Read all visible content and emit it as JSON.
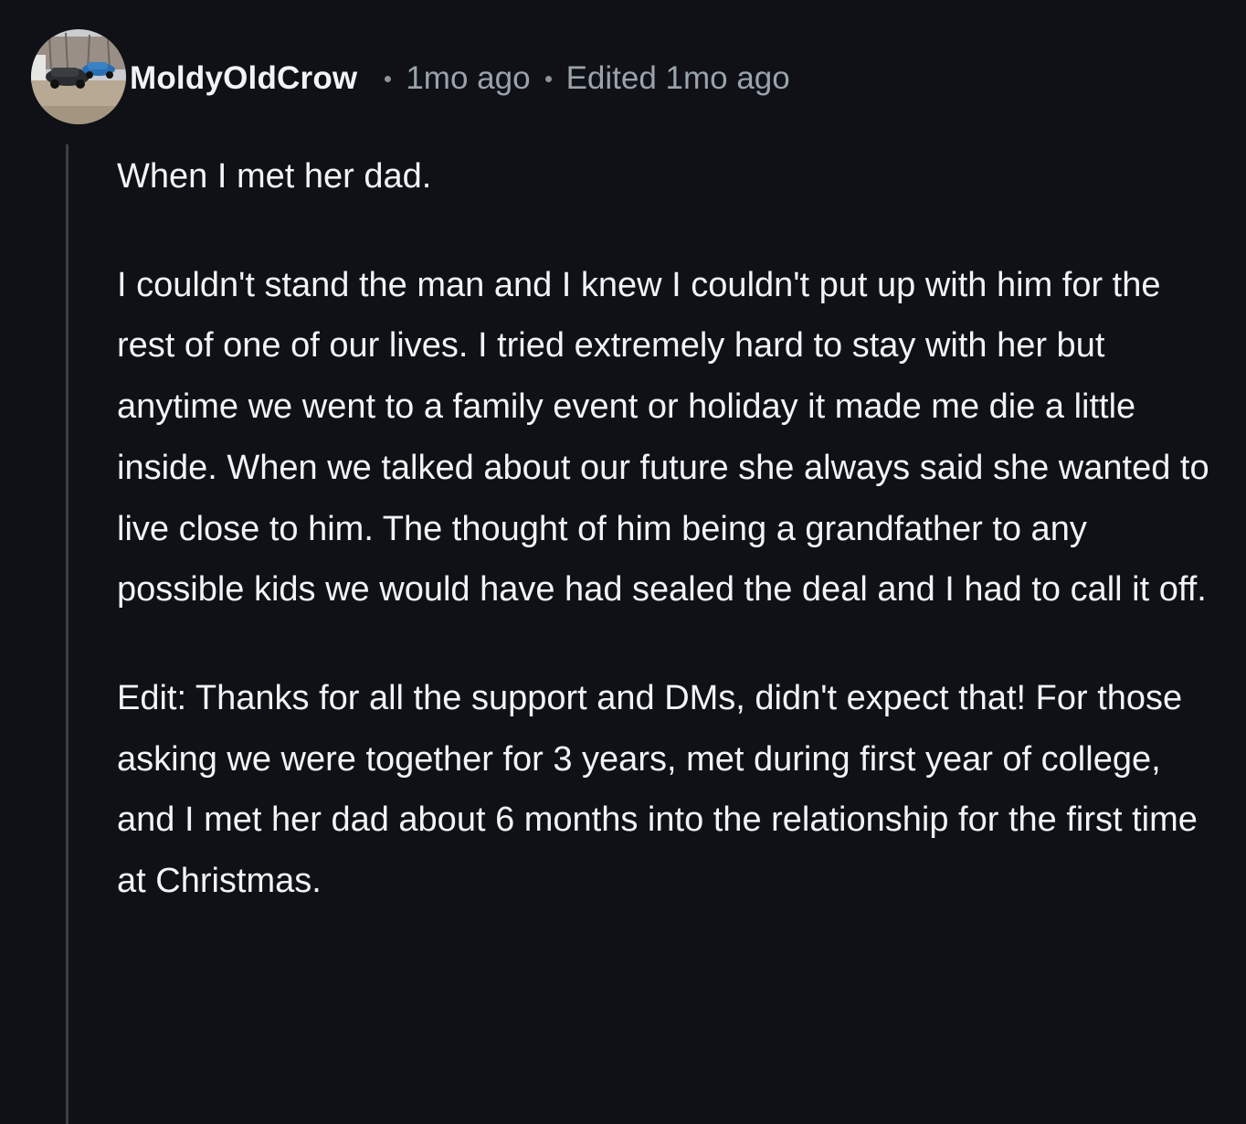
{
  "comment": {
    "author": "MoldyOldCrow",
    "posted_ago": "1mo ago",
    "edited_label": "Edited 1mo ago",
    "avatar_icon": "user-avatar-cars-photo",
    "paragraphs": [
      "When I met her dad.",
      "I couldn't stand the man and I knew I couldn't put up with him for the rest of one of our lives. I tried extremely hard to stay with her but anytime we went to a family event or holiday it made me die a little inside. When we talked about our future she always said she wanted to live close to him. The thought of him being a grandfather to any possible kids we would have had sealed the deal and I had to call it off.",
      "Edit: Thanks for all the support and DMs, didn't expect that! For those asking we were together for 3 years, met during first year of college, and I met her dad about 6 months into the relationship for the first time at Christmas."
    ]
  },
  "colors": {
    "background": "#0f1116",
    "text": "#f2f3f5",
    "meta_text": "#9aa3ab",
    "thread_line": "#3a3f45"
  }
}
